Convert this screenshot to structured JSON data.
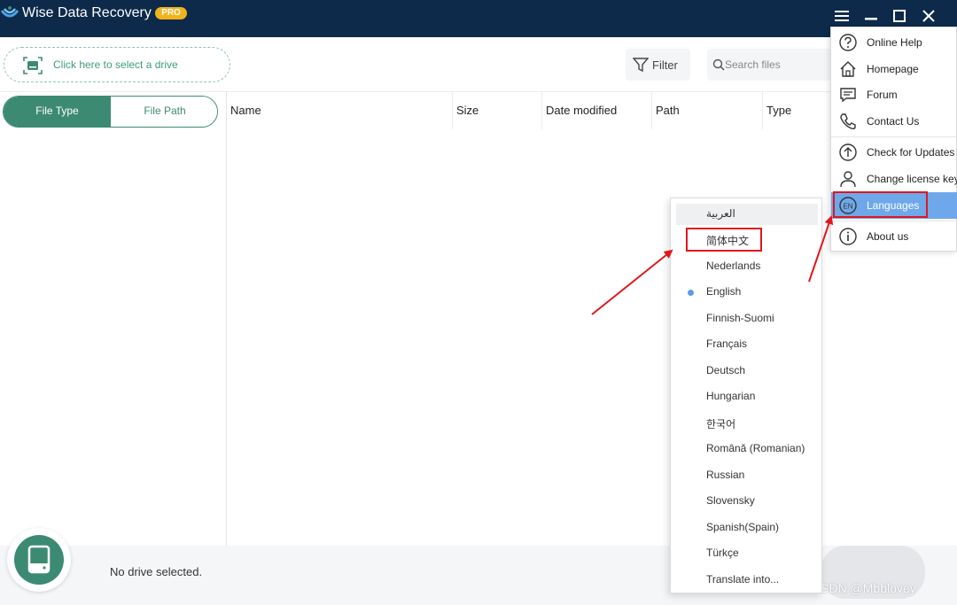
{
  "app": {
    "title": "Wise Data Recovery",
    "badge": "PRO"
  },
  "toolbar": {
    "drive_select_label": "Click here to select a drive",
    "filter_label": "Filter",
    "search_placeholder": "Search files"
  },
  "view_tabs": {
    "file_type": "File Type",
    "file_path": "File Path"
  },
  "table": {
    "columns": [
      "Name",
      "Size",
      "Date modified",
      "Path",
      "Type"
    ]
  },
  "status": {
    "no_drive": "No drive selected."
  },
  "main_menu": {
    "items": [
      {
        "label": "Online Help",
        "icon": "question-icon"
      },
      {
        "label": "Homepage",
        "icon": "home-icon"
      },
      {
        "label": "Forum",
        "icon": "forum-icon"
      },
      {
        "label": "Contact Us",
        "icon": "phone-icon"
      },
      {
        "label": "Check for Updates",
        "icon": "update-icon"
      },
      {
        "label": "Change license key",
        "icon": "user-icon"
      },
      {
        "label": "Languages",
        "icon": "language-en-icon",
        "active": true
      },
      {
        "label": "About us",
        "icon": "info-icon"
      }
    ]
  },
  "languages": {
    "selected": "English",
    "items": [
      "العربية",
      "简体中文",
      "Nederlands",
      "English",
      "Finnish-Suomi",
      "Français",
      "Deutsch",
      "Hungarian",
      "한국어",
      "Română (Romanian)",
      "Russian",
      "Slovensky",
      "Spanish(Spain)",
      "Türkçe",
      "Translate into..."
    ]
  },
  "watermark": "CSDN @Mbblovey",
  "colors": {
    "titlebar": "#0d2a4a",
    "accent_green": "#3d8a72",
    "menu_active": "#6ea8ea",
    "highlight_red": "#e2161c",
    "badge": "#f2b21a"
  }
}
